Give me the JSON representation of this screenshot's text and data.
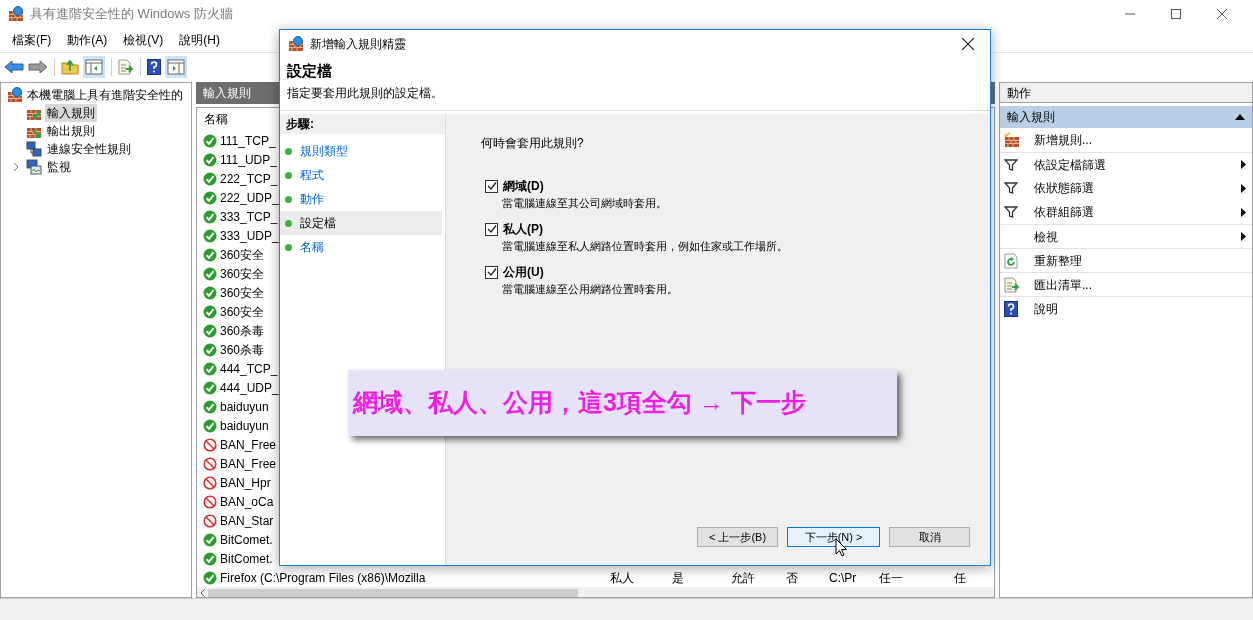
{
  "window": {
    "title": "具有進階安全性的 Windows 防火牆"
  },
  "menu": [
    "檔案(F)",
    "動作(A)",
    "檢視(V)",
    "說明(H)"
  ],
  "tree": {
    "label": "本機電腦上具有進階安全性的",
    "children": [
      {
        "label": "輸入規則",
        "kind": "inbound",
        "selected": true
      },
      {
        "label": "輸出規則",
        "kind": "outbound",
        "selected": false
      },
      {
        "label": "連線安全性規則",
        "kind": "connection",
        "selected": false
      },
      {
        "label": "監視",
        "kind": "monitor",
        "selected": false,
        "expanded": false
      }
    ]
  },
  "rules": {
    "title": "輸入規則",
    "columns": [
      "名稱"
    ],
    "rows": [
      {
        "name": "111_TCP_",
        "kind": "allow"
      },
      {
        "name": "111_UDP_",
        "kind": "allow"
      },
      {
        "name": "222_TCP_",
        "kind": "allow"
      },
      {
        "name": "222_UDP_",
        "kind": "allow"
      },
      {
        "name": "333_TCP_",
        "kind": "allow"
      },
      {
        "name": "333_UDP_",
        "kind": "allow"
      },
      {
        "name": "360安全",
        "kind": "allow"
      },
      {
        "name": "360安全",
        "kind": "allow"
      },
      {
        "name": "360安全",
        "kind": "allow"
      },
      {
        "name": "360安全",
        "kind": "allow"
      },
      {
        "name": "360杀毒",
        "kind": "allow"
      },
      {
        "name": "360杀毒",
        "kind": "allow"
      },
      {
        "name": "444_TCP_",
        "kind": "allow"
      },
      {
        "name": "444_UDP_",
        "kind": "allow"
      },
      {
        "name": "baiduyun",
        "kind": "allow"
      },
      {
        "name": "baiduyun",
        "kind": "allow"
      },
      {
        "name": "BAN_Free",
        "kind": "block"
      },
      {
        "name": "BAN_Free",
        "kind": "block"
      },
      {
        "name": "BAN_Hpr",
        "kind": "block"
      },
      {
        "name": "BAN_oCa",
        "kind": "block"
      },
      {
        "name": "BAN_Star",
        "kind": "block"
      },
      {
        "name": "BitComet.",
        "kind": "allow"
      },
      {
        "name": "BitComet.",
        "kind": "allow"
      },
      {
        "name": "Firefox (C:\\Program Files (x86)\\Mozilla",
        "kind": "allow",
        "cells": [
          "私人",
          "是",
          "允許",
          "否",
          "C:\\Pr",
          "任一",
          "任"
        ]
      }
    ]
  },
  "actions": {
    "title": "動作",
    "section": "輸入規則",
    "expanded": true,
    "items": [
      {
        "label": "新增規則...",
        "kind": "new",
        "submenu": false
      },
      {
        "label": "依設定檔篩選",
        "kind": "filter",
        "submenu": true
      },
      {
        "label": "依狀態篩選",
        "kind": "filter",
        "submenu": true
      },
      {
        "label": "依群組篩選",
        "kind": "filter",
        "submenu": true
      },
      {
        "label": "檢視",
        "kind": "view",
        "submenu": true
      },
      {
        "label": "重新整理",
        "kind": "refresh",
        "submenu": false
      },
      {
        "label": "匯出清單...",
        "kind": "export",
        "submenu": false
      },
      {
        "label": "說明",
        "kind": "help",
        "submenu": false
      }
    ]
  },
  "dialog": {
    "title": "新增輸入規則精靈",
    "heading": "設定檔",
    "subtitle": "指定要套用此規則的設定檔。",
    "steps_title": "步驟:",
    "steps": [
      {
        "label": "規則類型",
        "selected": false
      },
      {
        "label": "程式",
        "selected": false
      },
      {
        "label": "動作",
        "selected": false
      },
      {
        "label": "設定檔",
        "selected": true
      },
      {
        "label": "名稱",
        "selected": false
      }
    ],
    "question": "何時會套用此規則?",
    "options": [
      {
        "label": "網域(D)",
        "description": "當電腦連線至其公司網域時套用。",
        "checked": true
      },
      {
        "label": "私人(P)",
        "description": "當電腦連線至私人網路位置時套用，例如住家或工作場所。",
        "checked": true
      },
      {
        "label": "公用(U)",
        "description": "當電腦連線至公用網路位置時套用。",
        "checked": true
      }
    ],
    "buttons": [
      {
        "label": "< 上一步(B)",
        "focused": false
      },
      {
        "label": "下一步(N) >",
        "focused": true
      },
      {
        "label": "取消",
        "focused": false
      }
    ]
  },
  "callout": "網域、私人、公用，這3項全勾 → 下一步"
}
